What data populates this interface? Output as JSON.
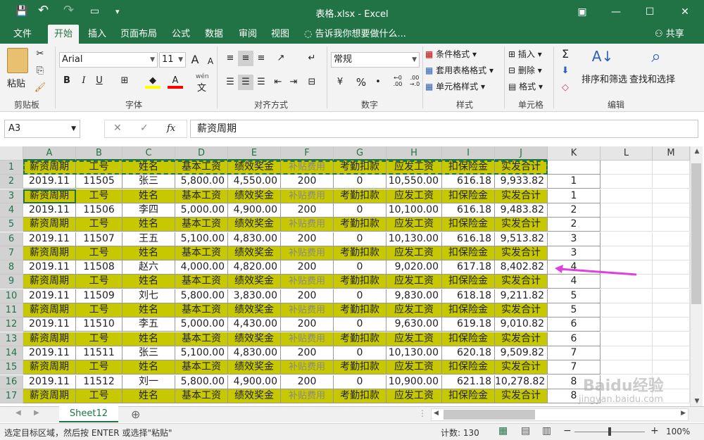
{
  "title_bar": {
    "title": "表格.xlsx - Excel",
    "save_icon": "💾",
    "undo_icon": "↶",
    "redo_icon": "↷",
    "touch_icon": "▭",
    "customize_icon": "▾",
    "ribbon_display_icon": "▣",
    "minimize": "—",
    "restore": "☐",
    "close": "✕"
  },
  "menu": {
    "items": [
      "文件",
      "开始",
      "插入",
      "页面布局",
      "公式",
      "数据",
      "审阅",
      "视图"
    ],
    "active": "开始",
    "tell_me": "告诉我你想要做什么...",
    "share": "共享"
  },
  "ribbon": {
    "paste": "粘贴",
    "clipboard_label": "剪贴板",
    "font_name": "Arial",
    "font_size": "11",
    "bold": "B",
    "italic": "I",
    "underline": "U",
    "grow": "A",
    "shrink": "A",
    "font_label": "字体",
    "phonetic_label": "wén",
    "phonetic_char": "文",
    "alignment_label": "对齐方式",
    "number_format": "常规",
    "percent": "%",
    "comma": "•",
    "number_label": "数字",
    "conditional": "条件格式",
    "table_format": "套用表格格式",
    "cell_style": "单元格样式",
    "styles_label": "样式",
    "insert": "插入",
    "delete": "删除",
    "format": "格式",
    "cells_label": "单元格",
    "sigma": "Σ",
    "sort_filter": "排序和筛选",
    "find_select": "查找和选择",
    "editing_label": "编辑",
    "accent": "#217346",
    "highlight_color": "#ffff00",
    "font_color": "#ff0000"
  },
  "formula_bar": {
    "name_box": "A3",
    "cancel": "✕",
    "enter": "✓",
    "fx": "fx",
    "content": "薪资周期"
  },
  "columns": [
    "A",
    "B",
    "C",
    "D",
    "E",
    "F",
    "G",
    "H",
    "I",
    "J",
    "K",
    "L",
    "M"
  ],
  "rows": [
    {
      "num": "1",
      "type": "header",
      "cells": [
        "薪资周期",
        "工号",
        "姓名",
        "基本工资",
        "绩效奖金",
        "补贴费用",
        "考勤扣款",
        "应发工资",
        "扣保险金",
        "实发合计"
      ],
      "k": ""
    },
    {
      "num": "2",
      "type": "data",
      "cells": [
        "2019.11",
        "11505",
        "张三",
        "5,800.00",
        "4,550.00",
        "200",
        "0",
        "10,550.00",
        "616.18",
        "9,933.82"
      ],
      "k": "1"
    },
    {
      "num": "3",
      "type": "header",
      "cells": [
        "薪资周期",
        "工号",
        "姓名",
        "基本工资",
        "绩效奖金",
        "补贴费用",
        "考勤扣款",
        "应发工资",
        "扣保险金",
        "实发合计"
      ],
      "k": "1"
    },
    {
      "num": "4",
      "type": "data",
      "cells": [
        "2019.11",
        "11506",
        "李四",
        "5,000.00",
        "4,900.00",
        "200",
        "0",
        "10,100.00",
        "616.18",
        "9,483.82"
      ],
      "k": "2"
    },
    {
      "num": "5",
      "type": "header",
      "cells": [
        "薪资周期",
        "工号",
        "姓名",
        "基本工资",
        "绩效奖金",
        "补贴费用",
        "考勤扣款",
        "应发工资",
        "扣保险金",
        "实发合计"
      ],
      "k": "2"
    },
    {
      "num": "6",
      "type": "data",
      "cells": [
        "2019.11",
        "11507",
        "王五",
        "5,100.00",
        "4,830.00",
        "200",
        "0",
        "10,130.00",
        "616.18",
        "9,513.82"
      ],
      "k": "3"
    },
    {
      "num": "7",
      "type": "header",
      "cells": [
        "薪资周期",
        "工号",
        "姓名",
        "基本工资",
        "绩效奖金",
        "补贴费用",
        "考勤扣款",
        "应发工资",
        "扣保险金",
        "实发合计"
      ],
      "k": "3"
    },
    {
      "num": "8",
      "type": "data",
      "cells": [
        "2019.11",
        "11508",
        "赵六",
        "4,000.00",
        "4,820.00",
        "200",
        "0",
        "9,020.00",
        "617.18",
        "8,402.82"
      ],
      "k": "4"
    },
    {
      "num": "9",
      "type": "header",
      "cells": [
        "薪资周期",
        "工号",
        "姓名",
        "基本工资",
        "绩效奖金",
        "补贴费用",
        "考勤扣款",
        "应发工资",
        "扣保险金",
        "实发合计"
      ],
      "k": "4"
    },
    {
      "num": "10",
      "type": "data",
      "cells": [
        "2019.11",
        "11509",
        "刘七",
        "5,800.00",
        "3,830.00",
        "200",
        "0",
        "9,830.00",
        "618.18",
        "9,211.82"
      ],
      "k": "5"
    },
    {
      "num": "11",
      "type": "header",
      "cells": [
        "薪资周期",
        "工号",
        "姓名",
        "基本工资",
        "绩效奖金",
        "补贴费用",
        "考勤扣款",
        "应发工资",
        "扣保险金",
        "实发合计"
      ],
      "k": "5"
    },
    {
      "num": "12",
      "type": "data",
      "cells": [
        "2019.11",
        "11510",
        "李五",
        "5,000.00",
        "4,430.00",
        "200",
        "0",
        "9,630.00",
        "619.18",
        "9,010.82"
      ],
      "k": "6"
    },
    {
      "num": "13",
      "type": "header",
      "cells": [
        "薪资周期",
        "工号",
        "姓名",
        "基本工资",
        "绩效奖金",
        "补贴费用",
        "考勤扣款",
        "应发工资",
        "扣保险金",
        "实发合计"
      ],
      "k": "6"
    },
    {
      "num": "14",
      "type": "data",
      "cells": [
        "2019.11",
        "11511",
        "张三",
        "5,100.00",
        "4,830.00",
        "200",
        "0",
        "10,130.00",
        "620.18",
        "9,509.82"
      ],
      "k": "7"
    },
    {
      "num": "15",
      "type": "header",
      "cells": [
        "薪资周期",
        "工号",
        "姓名",
        "基本工资",
        "绩效奖金",
        "补贴费用",
        "考勤扣款",
        "应发工资",
        "扣保险金",
        "实发合计"
      ],
      "k": "7"
    },
    {
      "num": "16",
      "type": "data",
      "cells": [
        "2019.11",
        "11512",
        "刘一",
        "5,800.00",
        "4,900.00",
        "200",
        "0",
        "10,900.00",
        "621.18",
        "10,278.82"
      ],
      "k": "8"
    },
    {
      "num": "17",
      "type": "header",
      "cells": [
        "薪资周期",
        "工号",
        "姓名",
        "基本工资",
        "绩效奖金",
        "补贴费用",
        "考勤扣款",
        "应发工资",
        "扣保险金",
        "实发合计"
      ],
      "k": "8"
    }
  ],
  "sheet_tab": "Sheet12",
  "add_sheet": "⊕",
  "status": {
    "message": "选定目标区域，然后按 ENTER 或选择\"粘贴\"",
    "count": "计数: 130",
    "zoom": "100%",
    "zoom_minus": "−",
    "zoom_plus": "+"
  },
  "colors": {
    "header_fill": "#c8c800",
    "arrow": "#e040e0",
    "excel_green": "#217346"
  },
  "watermark": {
    "brand": "Baidu经验",
    "url": "jingyan.baidu.com"
  }
}
